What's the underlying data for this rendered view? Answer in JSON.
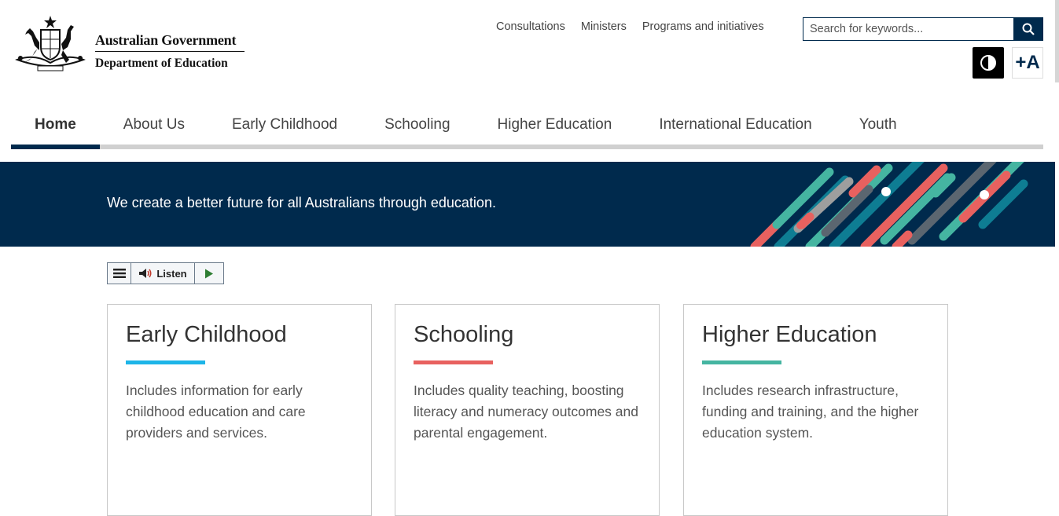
{
  "header": {
    "logo": {
      "line1": "Australian Government",
      "line2": "Department of Education",
      "icon": "coat-of-arms"
    },
    "utility_links": [
      "Consultations",
      "Ministers",
      "Programs and initiatives"
    ],
    "search": {
      "placeholder": "Search for keywords...",
      "icon": "search-icon"
    },
    "contrast_icon": "contrast-icon",
    "font_size_label": "+A"
  },
  "nav": {
    "items": [
      {
        "label": "Home",
        "active": true
      },
      {
        "label": "About Us"
      },
      {
        "label": "Early Childhood"
      },
      {
        "label": "Schooling"
      },
      {
        "label": "Higher Education"
      },
      {
        "label": "International Education"
      },
      {
        "label": "Youth"
      }
    ]
  },
  "banner": {
    "text": "We create a better future for all Australians through education.",
    "background": "#002a4d",
    "stripe_colors": [
      "#e8615f",
      "#45b5a1",
      "#0e7d93",
      "#9e9e9e",
      "#5b6670",
      "#ffffff"
    ]
  },
  "listen": {
    "label": "Listen",
    "icons": [
      "menu-icon",
      "speaker-icon",
      "play-icon"
    ]
  },
  "cards": [
    {
      "title": "Early Childhood",
      "text": "Includes information for early childhood education and care providers and services.",
      "accent": "#1db5e8"
    },
    {
      "title": "Schooling",
      "text": "Includes quality teaching, boosting literacy and numeracy outcomes and parental engagement.",
      "accent": "#e8615f"
    },
    {
      "title": "Higher Education",
      "text": "Includes research infrastructure, funding and training, and the higher education system.",
      "accent": "#45b5a1"
    }
  ]
}
